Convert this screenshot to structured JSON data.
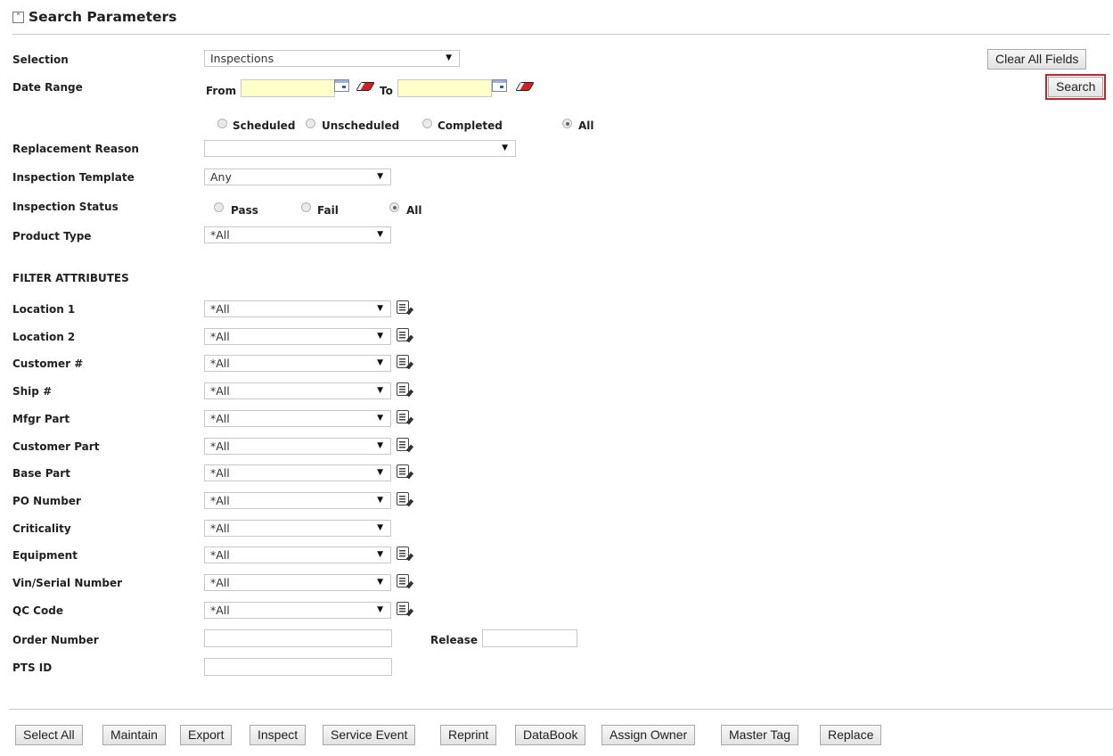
{
  "header": {
    "title": "Search Parameters"
  },
  "selection": {
    "label": "Selection",
    "value": "Inspections"
  },
  "date_range": {
    "label": "Date Range",
    "from_label": "From",
    "to_label": "To"
  },
  "schedule_filter": {
    "options": [
      "Scheduled",
      "Unscheduled",
      "Completed",
      "All"
    ],
    "selected": "All"
  },
  "replacement_reason": {
    "label": "Replacement Reason",
    "value": ""
  },
  "inspection_template": {
    "label": "Inspection Template",
    "value": "Any"
  },
  "inspection_status": {
    "label": "Inspection Status",
    "options": [
      "Pass",
      "Fail",
      "All"
    ],
    "selected": "All"
  },
  "product_type": {
    "label": "Product Type",
    "value": "*All"
  },
  "filter_attributes": {
    "heading": "FILTER ATTRIBUTES",
    "rows": [
      {
        "label": "Location 1",
        "value": "*All",
        "has_list_icon": true
      },
      {
        "label": "Location 2",
        "value": "*All",
        "has_list_icon": true
      },
      {
        "label": "Customer #",
        "value": "*All",
        "has_list_icon": true
      },
      {
        "label": "Ship #",
        "value": "*All",
        "has_list_icon": true
      },
      {
        "label": "Mfgr Part",
        "value": "*All",
        "has_list_icon": true
      },
      {
        "label": "Customer Part",
        "value": "*All",
        "has_list_icon": true
      },
      {
        "label": "Base Part",
        "value": "*All",
        "has_list_icon": true
      },
      {
        "label": "PO Number",
        "value": "*All",
        "has_list_icon": true
      },
      {
        "label": "Criticality",
        "value": "*All",
        "has_list_icon": false
      },
      {
        "label": "Equipment",
        "value": "*All",
        "has_list_icon": true
      },
      {
        "label": "Vin/Serial Number",
        "value": "*All",
        "has_list_icon": true
      },
      {
        "label": "QC Code",
        "value": "*All",
        "has_list_icon": true
      }
    ]
  },
  "order_number": {
    "label": "Order Number",
    "release_label": "Release"
  },
  "pts_id": {
    "label": "PTS ID"
  },
  "actions": {
    "clear_all": "Clear All Fields",
    "search": "Search"
  },
  "toolbar": {
    "buttons": [
      "Select All",
      "Maintain",
      "Export",
      "Inspect",
      "Service Event",
      "Reprint",
      "DataBook",
      "Assign Owner",
      "Master Tag",
      "Replace"
    ]
  },
  "colors": {
    "date_field_bg": "#ffffc8",
    "highlight_outline": "#c0262d"
  }
}
